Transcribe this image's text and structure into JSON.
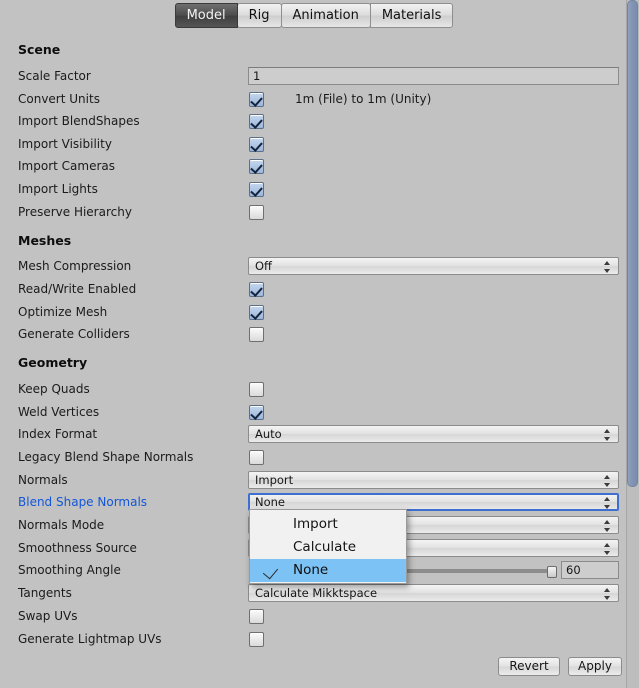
{
  "tabs": [
    {
      "label": "Model",
      "active": true
    },
    {
      "label": "Rig",
      "active": false
    },
    {
      "label": "Animation",
      "active": false
    },
    {
      "label": "Materials",
      "active": false
    }
  ],
  "sections": {
    "scene": {
      "title": "Scene",
      "scale_factor": {
        "label": "Scale Factor",
        "value": "1"
      },
      "convert_units": {
        "label": "Convert Units",
        "checked": true,
        "note": "1m (File) to 1m (Unity)"
      },
      "import_blendshapes": {
        "label": "Import BlendShapes",
        "checked": true
      },
      "import_visibility": {
        "label": "Import Visibility",
        "checked": true
      },
      "import_cameras": {
        "label": "Import Cameras",
        "checked": true
      },
      "import_lights": {
        "label": "Import Lights",
        "checked": true
      },
      "preserve_hierarchy": {
        "label": "Preserve Hierarchy",
        "checked": false
      }
    },
    "meshes": {
      "title": "Meshes",
      "mesh_compression": {
        "label": "Mesh Compression",
        "value": "Off"
      },
      "read_write_enabled": {
        "label": "Read/Write Enabled",
        "checked": true
      },
      "optimize_mesh": {
        "label": "Optimize Mesh",
        "checked": true
      },
      "generate_colliders": {
        "label": "Generate Colliders",
        "checked": false
      }
    },
    "geometry": {
      "title": "Geometry",
      "keep_quads": {
        "label": "Keep Quads",
        "checked": false
      },
      "weld_vertices": {
        "label": "Weld Vertices",
        "checked": true
      },
      "index_format": {
        "label": "Index Format",
        "value": "Auto"
      },
      "legacy_blend_shape_normals": {
        "label": "Legacy Blend Shape Normals",
        "checked": false
      },
      "normals": {
        "label": "Normals",
        "value": "Import"
      },
      "blend_shape_normals": {
        "label": "Blend Shape Normals",
        "value": "None",
        "highlighted": true,
        "focused": true
      },
      "normals_mode": {
        "label": "Normals Mode",
        "value": ""
      },
      "smoothness_source": {
        "label": "Smoothness Source",
        "value": ""
      },
      "smoothing_angle": {
        "label": "Smoothing Angle",
        "value": "60"
      },
      "tangents": {
        "label": "Tangents",
        "value": "Calculate Mikktspace"
      },
      "swap_uvs": {
        "label": "Swap UVs",
        "checked": false
      },
      "generate_lightmap_uvs": {
        "label": "Generate Lightmap UVs",
        "checked": false
      }
    }
  },
  "dropdown_menu": {
    "open": true,
    "items": [
      {
        "label": "Import",
        "selected": false
      },
      {
        "label": "Calculate",
        "selected": false
      },
      {
        "label": "None",
        "selected": true
      }
    ]
  },
  "footer": {
    "revert_label": "Revert",
    "apply_label": "Apply"
  },
  "colors": {
    "background": "#c2c2c2",
    "highlight_label": "#1356d8",
    "menu_selection": "#7dc2f5",
    "focus_border": "#3d6fd1",
    "scrollbar_thumb": "#8496b6"
  }
}
